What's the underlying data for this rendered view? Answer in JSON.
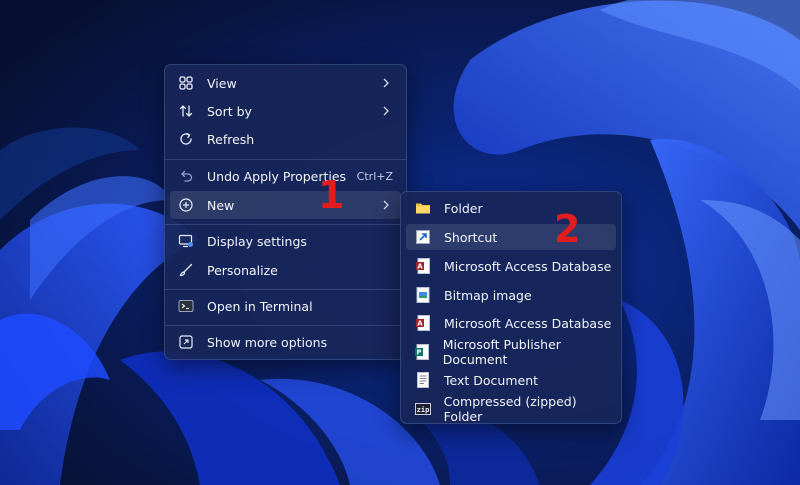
{
  "context_menu": {
    "items": [
      {
        "label": "View",
        "icon": "view-grid-icon",
        "has_submenu": true
      },
      {
        "label": "Sort by",
        "icon": "sort-icon",
        "has_submenu": true
      },
      {
        "label": "Refresh",
        "icon": "refresh-icon"
      },
      {
        "label": "Undo Apply Properties",
        "icon": "undo-icon",
        "shortcut": "Ctrl+Z"
      },
      {
        "label": "New",
        "icon": "new-plus-icon",
        "has_submenu": true,
        "highlighted": true
      },
      {
        "label": "Display settings",
        "icon": "display-settings-icon"
      },
      {
        "label": "Personalize",
        "icon": "personalize-brush-icon"
      },
      {
        "label": "Open in Terminal",
        "icon": "terminal-icon"
      },
      {
        "label": "Show more options",
        "icon": "show-more-options-icon"
      }
    ]
  },
  "new_submenu": {
    "items": [
      {
        "label": "Folder",
        "icon": "folder-icon"
      },
      {
        "label": "Shortcut",
        "icon": "shortcut-icon",
        "highlighted": true
      },
      {
        "label": "Microsoft Access Database",
        "icon": "access-database-icon"
      },
      {
        "label": "Bitmap image",
        "icon": "bitmap-image-icon"
      },
      {
        "label": "Microsoft Access Database",
        "icon": "access-database-icon"
      },
      {
        "label": "Microsoft Publisher Document",
        "icon": "publisher-document-icon"
      },
      {
        "label": "Text Document",
        "icon": "text-document-icon"
      },
      {
        "label": "Compressed (zipped) Folder",
        "icon": "zip-folder-icon"
      }
    ]
  },
  "annotations": {
    "step_1": "1",
    "step_2": "2"
  },
  "colors": {
    "step_marker": "#e11d1d",
    "wallpaper_accent": "#1f4bff",
    "menu_bg": "#182658"
  }
}
